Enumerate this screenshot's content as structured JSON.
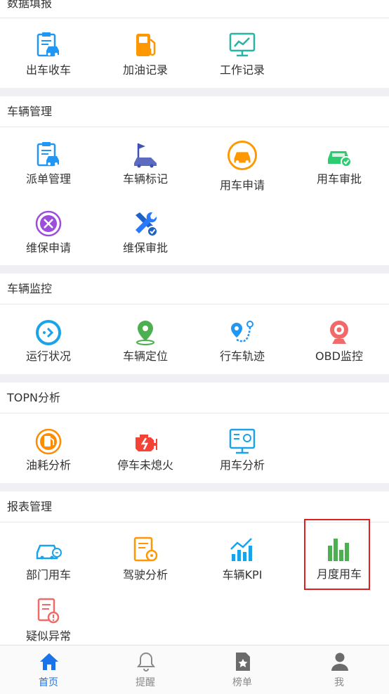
{
  "sections": {
    "data_entry": {
      "title": "数据填报",
      "items": [
        "出车收车",
        "加油记录",
        "工作记录"
      ]
    },
    "vehicle_mgmt": {
      "title": "车辆管理",
      "items": [
        "派单管理",
        "车辆标记",
        "用车申请",
        "用车审批",
        "维保申请",
        "维保审批"
      ]
    },
    "vehicle_monitor": {
      "title": "车辆监控",
      "items": [
        "运行状况",
        "车辆定位",
        "行车轨迹",
        "OBD监控"
      ]
    },
    "topn": {
      "title": "TOPN分析",
      "items": [
        "油耗分析",
        "停车未熄火",
        "用车分析"
      ]
    },
    "reports": {
      "title": "报表管理",
      "items": [
        "部门用车",
        "驾驶分析",
        "车辆KPI",
        "月度用车",
        "疑似异常"
      ]
    }
  },
  "tabbar": {
    "items": [
      "首页",
      "提醒",
      "榜单",
      "我"
    ],
    "active_index": 0
  },
  "colors": {
    "accent": "#1a73e8",
    "highlight": "#e02020",
    "divider": "#efeff4"
  }
}
